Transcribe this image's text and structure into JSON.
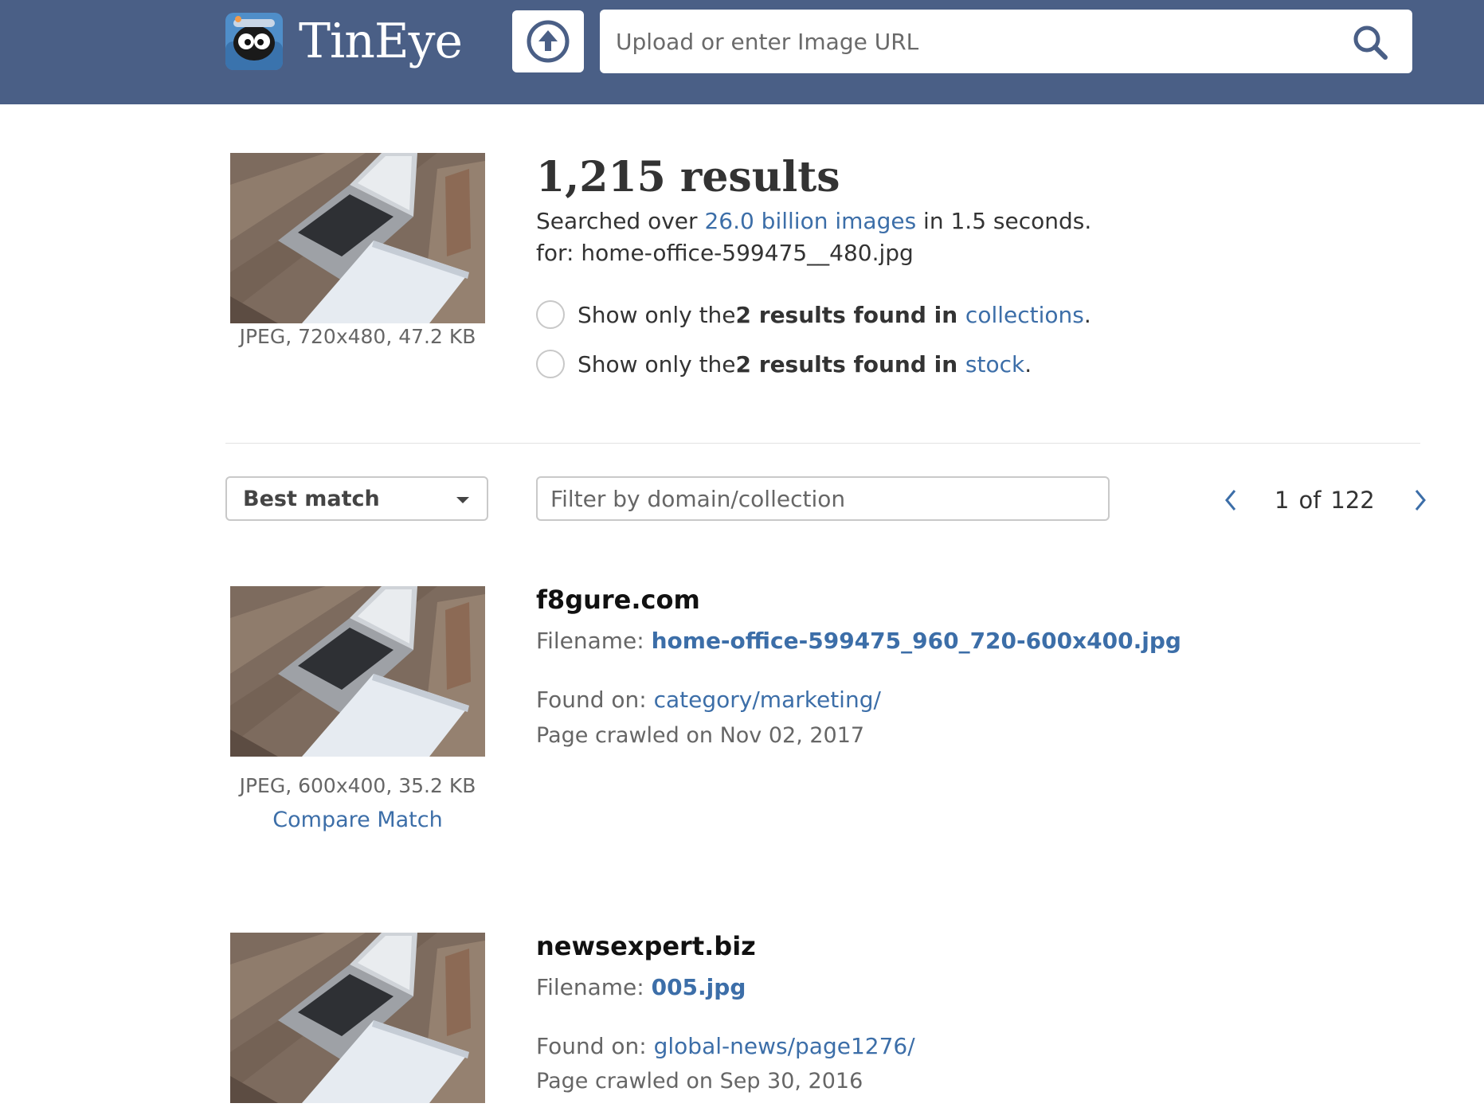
{
  "header": {
    "brand": "TinEye",
    "search_placeholder": "Upload or enter Image URL",
    "colors": {
      "bar": "#4a5f86",
      "link": "#3c6ea8"
    }
  },
  "query": {
    "thumb_meta": "JPEG, 720x480, 47.2 KB",
    "results_count": "1,215 results",
    "searched_prefix": "Searched over ",
    "searched_link": "26.0 billion images",
    "searched_suffix": " in 1.5 seconds.",
    "for_line": "for: home-office-599475__480.jpg",
    "filters": [
      {
        "prefix": "Show only the ",
        "bold": "2 results found in ",
        "link": "collections",
        "suffix": "."
      },
      {
        "prefix": "Show only the ",
        "bold": "2 results found in ",
        "link": "stock",
        "suffix": "."
      }
    ]
  },
  "controls": {
    "sort_value": "Best match",
    "filter_placeholder": "Filter by domain/collection",
    "page_current": "1",
    "page_of": "of",
    "page_total": "122"
  },
  "results": [
    {
      "domain": "f8gure.com",
      "filename_label": "Filename: ",
      "filename": "home-office-599475_960_720-600x400.jpg",
      "found_label": "Found on: ",
      "found_on": "category/marketing/",
      "crawled": "Page crawled on Nov 02, 2017",
      "thumb_meta": "JPEG, 600x400, 35.2 KB",
      "compare": "Compare Match"
    },
    {
      "domain": "newsexpert.biz",
      "filename_label": "Filename: ",
      "filename": "005.jpg",
      "found_label": "Found on: ",
      "found_on": "global-news/page1276/",
      "crawled": "Page crawled on Sep 30, 2016"
    }
  ]
}
